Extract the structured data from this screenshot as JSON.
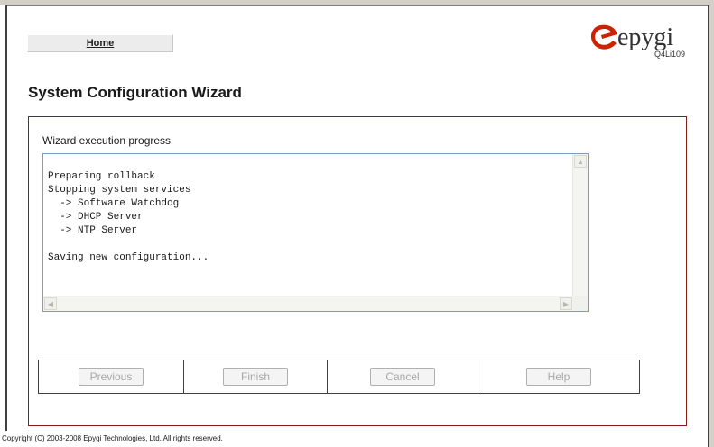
{
  "nav": {
    "home_label": "Home"
  },
  "brand": {
    "logo_text": "epygi",
    "model": "Q4Li109",
    "accent_color": "#cc2200"
  },
  "page": {
    "title": "System Configuration Wizard"
  },
  "wizard": {
    "progress_label": "Wizard execution progress",
    "log_lines": "Preparing rollback\nStopping system services\n  -> Software Watchdog\n  -> DHCP Server\n  -> NTP Server\n\nSaving new configuration...",
    "buttons": {
      "previous": "Previous",
      "finish": "Finish",
      "cancel": "Cancel",
      "help": "Help"
    }
  },
  "footer": {
    "prefix": "Copyright (C) 2003-2008 ",
    "company_link": "Epygi Technologies, Ltd",
    "suffix": ". All rights reserved."
  },
  "icons": {
    "logo": "epygi-e-logo-icon",
    "scroll_up": "scroll-up-arrow-icon",
    "scroll_left": "scroll-left-arrow-icon",
    "scroll_right": "scroll-right-arrow-icon"
  }
}
